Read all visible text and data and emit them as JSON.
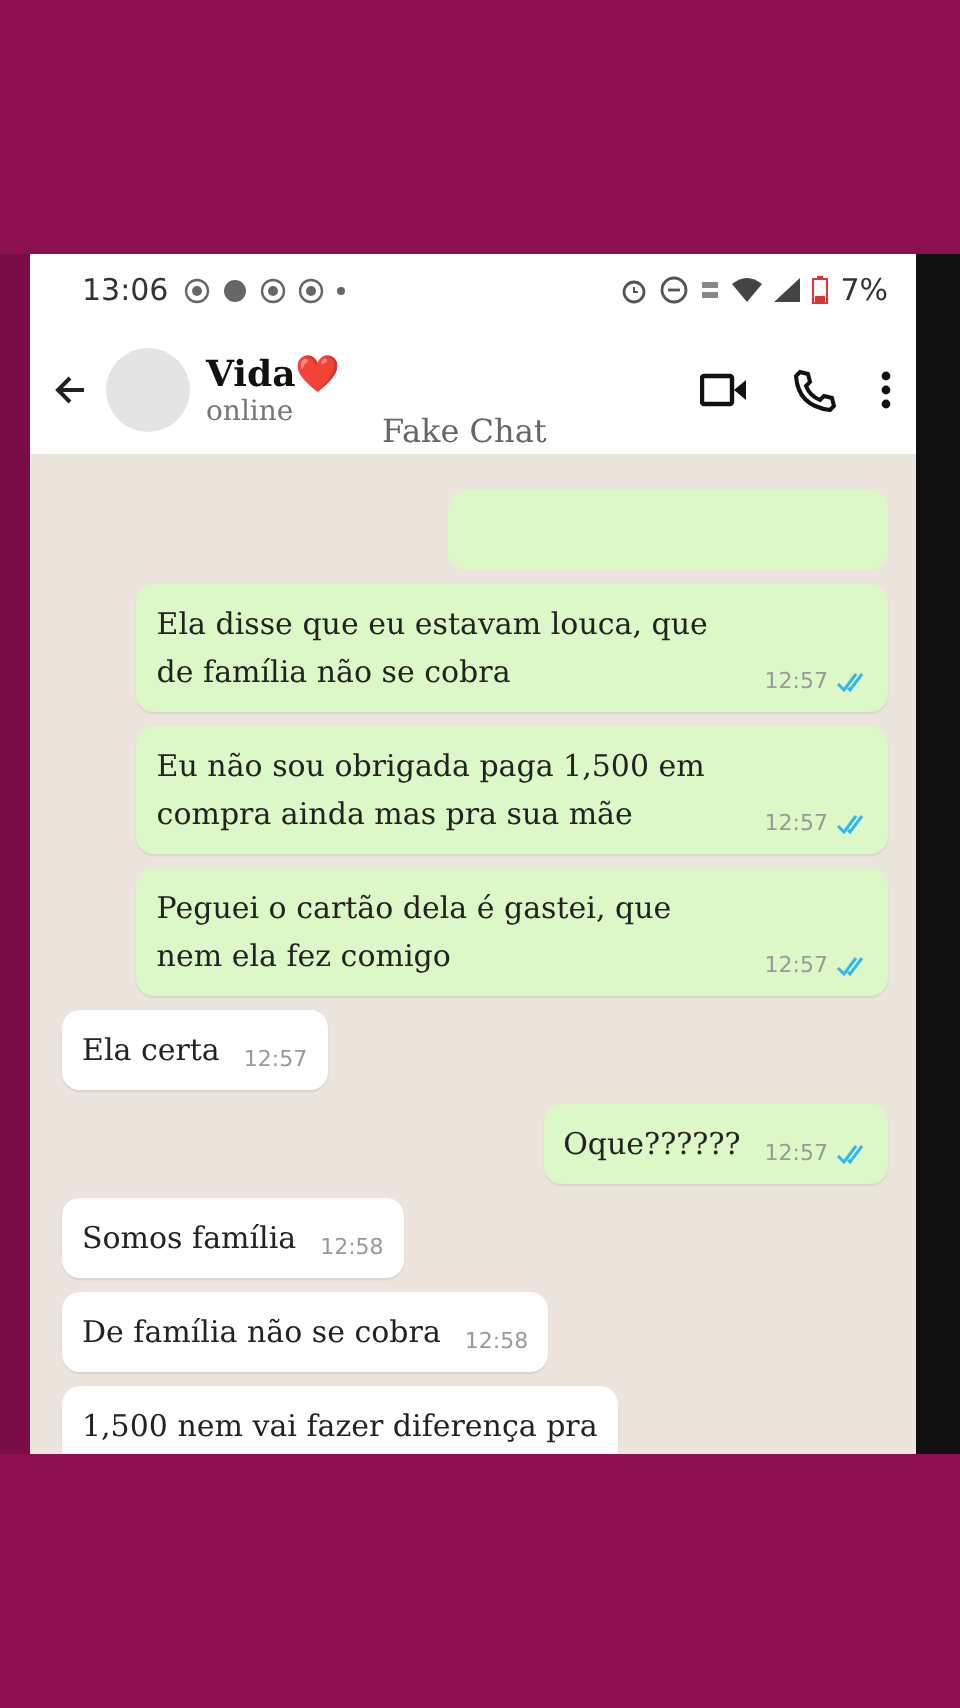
{
  "status_bar": {
    "time": "13:06",
    "battery": "7%"
  },
  "header": {
    "contact_name": "Vida❤️",
    "status": "online",
    "app_label": "Fake Chat"
  },
  "messages": [
    {
      "kind": "partial_out"
    },
    {
      "kind": "out",
      "text": "Ela disse que eu estavam louca, que de família não se cobra",
      "time": "12:57"
    },
    {
      "kind": "out",
      "text": "Eu não sou obrigada paga 1,500 em compra ainda mas pra sua mãe",
      "time": "12:57"
    },
    {
      "kind": "out",
      "text": "Peguei o cartão dela é gastei, que nem ela fez comigo",
      "time": "12:57"
    },
    {
      "kind": "in",
      "text": "Ela certa",
      "time": "12:57"
    },
    {
      "kind": "out",
      "text": "Oque??????",
      "time": "12:57"
    },
    {
      "kind": "in",
      "text": "Somos família",
      "time": "12:58"
    },
    {
      "kind": "in",
      "text": "De família não se cobra",
      "time": "12:58"
    },
    {
      "kind": "cut_in",
      "text": "1,500 nem vai fazer diferença pra"
    }
  ]
}
